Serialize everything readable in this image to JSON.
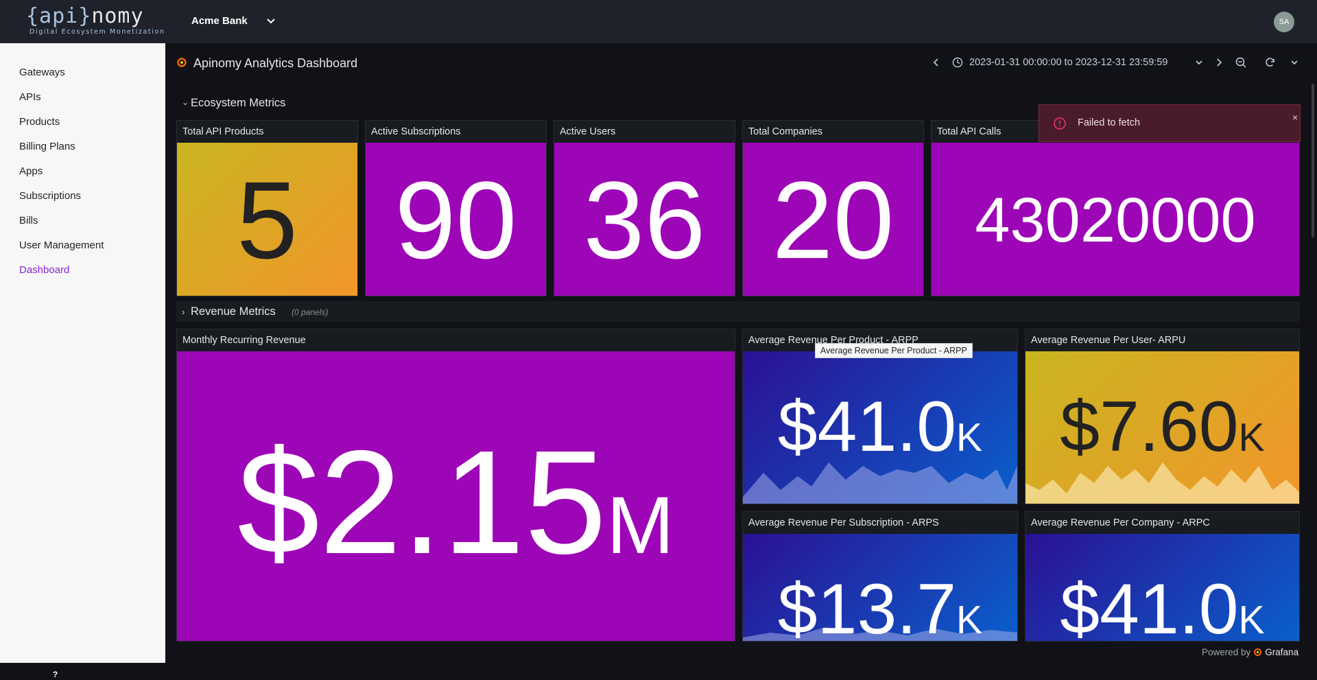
{
  "topbar": {
    "logo_main_pre": "{api}",
    "logo_main_post": "nomy",
    "logo_sub": "Digital Ecosystem Monetization",
    "org_name": "Acme Bank",
    "avatar_initials": "SA"
  },
  "sidebar": {
    "items": [
      {
        "label": "Gateways"
      },
      {
        "label": "APIs"
      },
      {
        "label": "Products"
      },
      {
        "label": "Billing Plans"
      },
      {
        "label": "Apps"
      },
      {
        "label": "Subscriptions"
      },
      {
        "label": "Bills"
      },
      {
        "label": "User Management"
      },
      {
        "label": "Dashboard",
        "active": true
      }
    ],
    "support_label": "Get support"
  },
  "dashboard": {
    "title": "Apinomy Analytics Dashboard",
    "time_range": "2023-01-31 00:00:00 to 2023-12-31 23:59:59"
  },
  "rows": {
    "ecosystem": {
      "title": "Ecosystem Metrics"
    },
    "revenue": {
      "title": "Revenue Metrics",
      "sub": "(0 panels)"
    }
  },
  "stats": {
    "total_api_products": {
      "title": "Total API Products",
      "value": "5"
    },
    "active_subscriptions": {
      "title": "Active Subscriptions",
      "value": "90"
    },
    "active_users": {
      "title": "Active Users",
      "value": "36"
    },
    "total_companies": {
      "title": "Total Companies",
      "value": "20"
    },
    "total_api_calls": {
      "title": "Total API Calls",
      "value": "43020000"
    },
    "mrr": {
      "title": "Monthly Recurring Revenue",
      "value": "$2.15",
      "unit": "M"
    },
    "arpp": {
      "title": "Average Revenue Per Product - ARPP",
      "value": "$41.0",
      "unit": "K"
    },
    "arpu": {
      "title": "Average Revenue Per User- ARPU",
      "value": "$7.60",
      "unit": "K"
    },
    "arps": {
      "title": "Average Revenue Per Subscription - ARPS",
      "value": "$13.7",
      "unit": "K"
    },
    "arpc": {
      "title": "Average Revenue Per Company - ARPC",
      "value": "$41.0",
      "unit": "K"
    }
  },
  "toast": {
    "message": "Failed to fetch",
    "close": "×"
  },
  "tooltip": {
    "text": "Average Revenue Per Product - ARPP"
  },
  "footer": {
    "powered_by": "Powered by",
    "brand": "Grafana"
  },
  "colors": {
    "purple": "#9d06b6",
    "gold_start": "#c9b520",
    "gold_end": "#f2962a",
    "blue_start": "#2b1193",
    "blue_end": "#0a5fcc",
    "accent_nav": "#8a25d4",
    "error": "#e02f6a"
  }
}
